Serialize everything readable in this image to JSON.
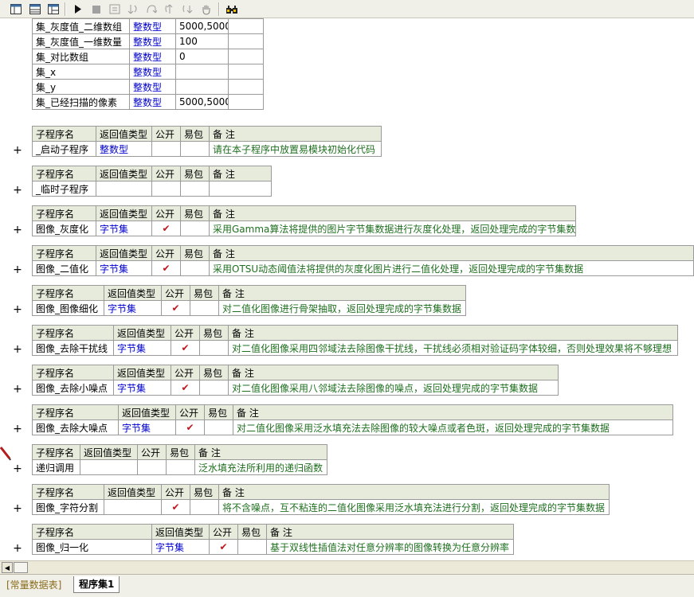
{
  "toolbar": {
    "icons": [
      "layout-icon",
      "table-view-icon",
      "split-view-icon",
      "run-icon",
      "stop-icon",
      "step-icon",
      "step-into-icon",
      "step-over-icon",
      "step-out-icon",
      "run-to-cursor-icon",
      "hand-icon",
      "find-icon"
    ]
  },
  "variables": {
    "rows": [
      {
        "name": "集_灰度值_二维数组",
        "type": "整数型",
        "value": "5000,5000"
      },
      {
        "name": "集_灰度值_一维数量",
        "type": "整数型",
        "value": "100"
      },
      {
        "name": "集_对比数组",
        "type": "整数型",
        "value": "0"
      },
      {
        "name": "集_x",
        "type": "整数型",
        "value": ""
      },
      {
        "name": "集_y",
        "type": "整数型",
        "value": ""
      },
      {
        "name": "集_已经扫描的像素",
        "type": "整数型",
        "value": "5000,5000"
      }
    ]
  },
  "headers": {
    "name": "子程序名",
    "ret": "返回值类型",
    "pub": "公开",
    "easy": "易包",
    "note": "备 注"
  },
  "expand_symbol": "+",
  "subs": [
    {
      "name": "_启动子程序",
      "ret": "整数型",
      "pub": false,
      "note": "请在本子程序中放置易模块初始化代码"
    },
    {
      "name": "_临时子程序",
      "ret": "",
      "pub": false,
      "note": ""
    },
    {
      "name": "图像_灰度化",
      "ret": "字节集",
      "pub": true,
      "note": "采用Gamma算法将提供的图片字节集数据进行灰度化处理，返回处理完成的字节集数据"
    },
    {
      "name": "图像_二值化",
      "ret": "字节集",
      "pub": true,
      "note": "采用OTSU动态阈值法将提供的灰度化图片进行二值化处理，返回处理完成的字节集数据"
    },
    {
      "name": "图像_图像细化",
      "ret": "字节集",
      "pub": true,
      "note": "对二值化图像进行骨架抽取，返回处理完成的字节集数据"
    },
    {
      "name": "图像_去除干扰线",
      "ret": "字节集",
      "pub": true,
      "note": "对二值化图像采用四邻域法去除图像干扰线，干扰线必须相对验证码字体较细，否则处理效果将不够理想"
    },
    {
      "name": "图像_去除小噪点",
      "ret": "字节集",
      "pub": true,
      "note": "对二值化图像采用八邻域法去除图像的噪点，返回处理完成的字节集数据"
    },
    {
      "name": "图像_去除大噪点",
      "ret": "字节集",
      "pub": true,
      "note": "对二值化图像采用泛水填充法去除图像的较大噪点或者色斑，返回处理完成的字节集数据"
    },
    {
      "name": "递归调用",
      "ret": "",
      "pub": false,
      "note": "泛水填充法所利用的递归函数"
    },
    {
      "name": "图像_字符分割",
      "ret": "",
      "pub": true,
      "note": "将不含噪点，互不粘连的二值化图像采用泛水填充法进行分割，返回处理完成的字节集数据"
    },
    {
      "name": "图像_归一化",
      "ret": "字节集",
      "pub": true,
      "note": "基于双线性插值法对任意分辨率的图像转换为任意分辨率"
    }
  ],
  "tabs": {
    "constants": "[常量数据表]",
    "module": "程序集1"
  },
  "colors": {
    "header_bg": "#e6ebdc",
    "type_blue": "#0000cc",
    "note_green": "#1f6f1f",
    "check_red": "#c0161d"
  }
}
